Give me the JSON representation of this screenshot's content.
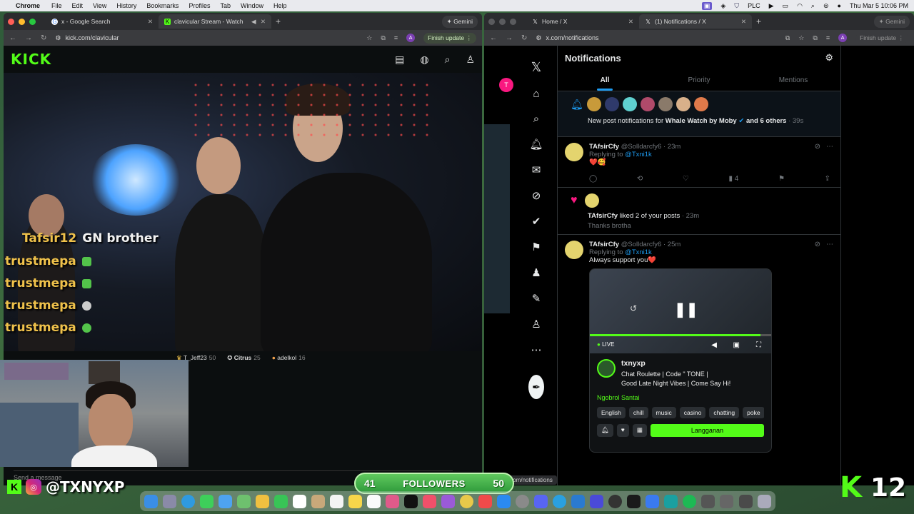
{
  "menubar": {
    "app": "Chrome",
    "items": [
      "File",
      "Edit",
      "View",
      "History",
      "Bookmarks",
      "Profiles",
      "Tab",
      "Window",
      "Help"
    ],
    "plc": "PLC",
    "clock": "Thu Mar 5  10:06 PM"
  },
  "left_window": {
    "tabs": [
      {
        "title": "x - Google Search"
      },
      {
        "title": "clavicular Stream - Watch"
      }
    ],
    "gemini": "Gemini",
    "url": "kick.com/clavicular",
    "profile_initial": "A",
    "finish_update": "Finish update"
  },
  "kick": {
    "logo": "KICK",
    "chat_overlay": [
      {
        "user": "Tafsir12",
        "msg": "GN brother"
      },
      {
        "user": "trustmepa",
        "msg": ""
      },
      {
        "user": "trustmepa",
        "msg": ""
      },
      {
        "user": "trustmepa",
        "msg": ""
      },
      {
        "user": "trustmepa",
        "msg": ""
      }
    ],
    "leaderboard": [
      {
        "name": "T_Jeff23",
        "val": "50"
      },
      {
        "name": "Citrus",
        "val": "25"
      },
      {
        "name": "adelkol",
        "val": "16"
      }
    ],
    "send_placeholder": "Send a message"
  },
  "overlay": {
    "handle": "@TXNYXP",
    "followers_count": "41",
    "followers_label": "FOLLOWERS",
    "followers_goal": "50",
    "big_k": "K",
    "big_number": "12"
  },
  "right_window": {
    "tabs": [
      {
        "title": "Home / X"
      },
      {
        "title": "(1) Notifications / X"
      }
    ],
    "gemini": "Gemini",
    "url": "x.com/notifications",
    "profile_initial": "A",
    "finish_update": "Finish update",
    "tooltip": "https://x.com/notifications"
  },
  "x": {
    "avatar_initial": "T",
    "title": "Notifications",
    "tabs": [
      "All",
      "Priority",
      "Mentions"
    ],
    "group_notif": {
      "prefix": "New post notifications for ",
      "account": "Whale Watch by Moby",
      "suffix": " and 6 others",
      "time": "· 39s"
    },
    "post1": {
      "name": "TAfsirCfy",
      "handle": "@Solldarcfy6 · 23m",
      "replying": "Replying to ",
      "reply_to": "@Txni1k",
      "text": "❤️🥰",
      "views": "4"
    },
    "like_notif": {
      "name": "TAfsirCfy",
      "text": " liked 2 of your posts",
      "time": " · 23m",
      "quote": "Thanks brotha"
    },
    "post2": {
      "name": "TAfsirCfy",
      "handle": "@Solldarcfy6 · 25m",
      "replying": "Replying to ",
      "reply_to": "@Txni1k",
      "text": "Always support you❤️",
      "embed": {
        "live": "LIVE",
        "streamer": "txnyxp",
        "title1": "Chat Roulette | Code \" TONE |",
        "title2": "Good Late Night Vibes | Come Say Hi!",
        "category": "Ngobrol Santai",
        "tags": [
          "English",
          "chill",
          "music",
          "casino",
          "chatting",
          "poke"
        ],
        "subscribe": "Langganan"
      }
    }
  }
}
